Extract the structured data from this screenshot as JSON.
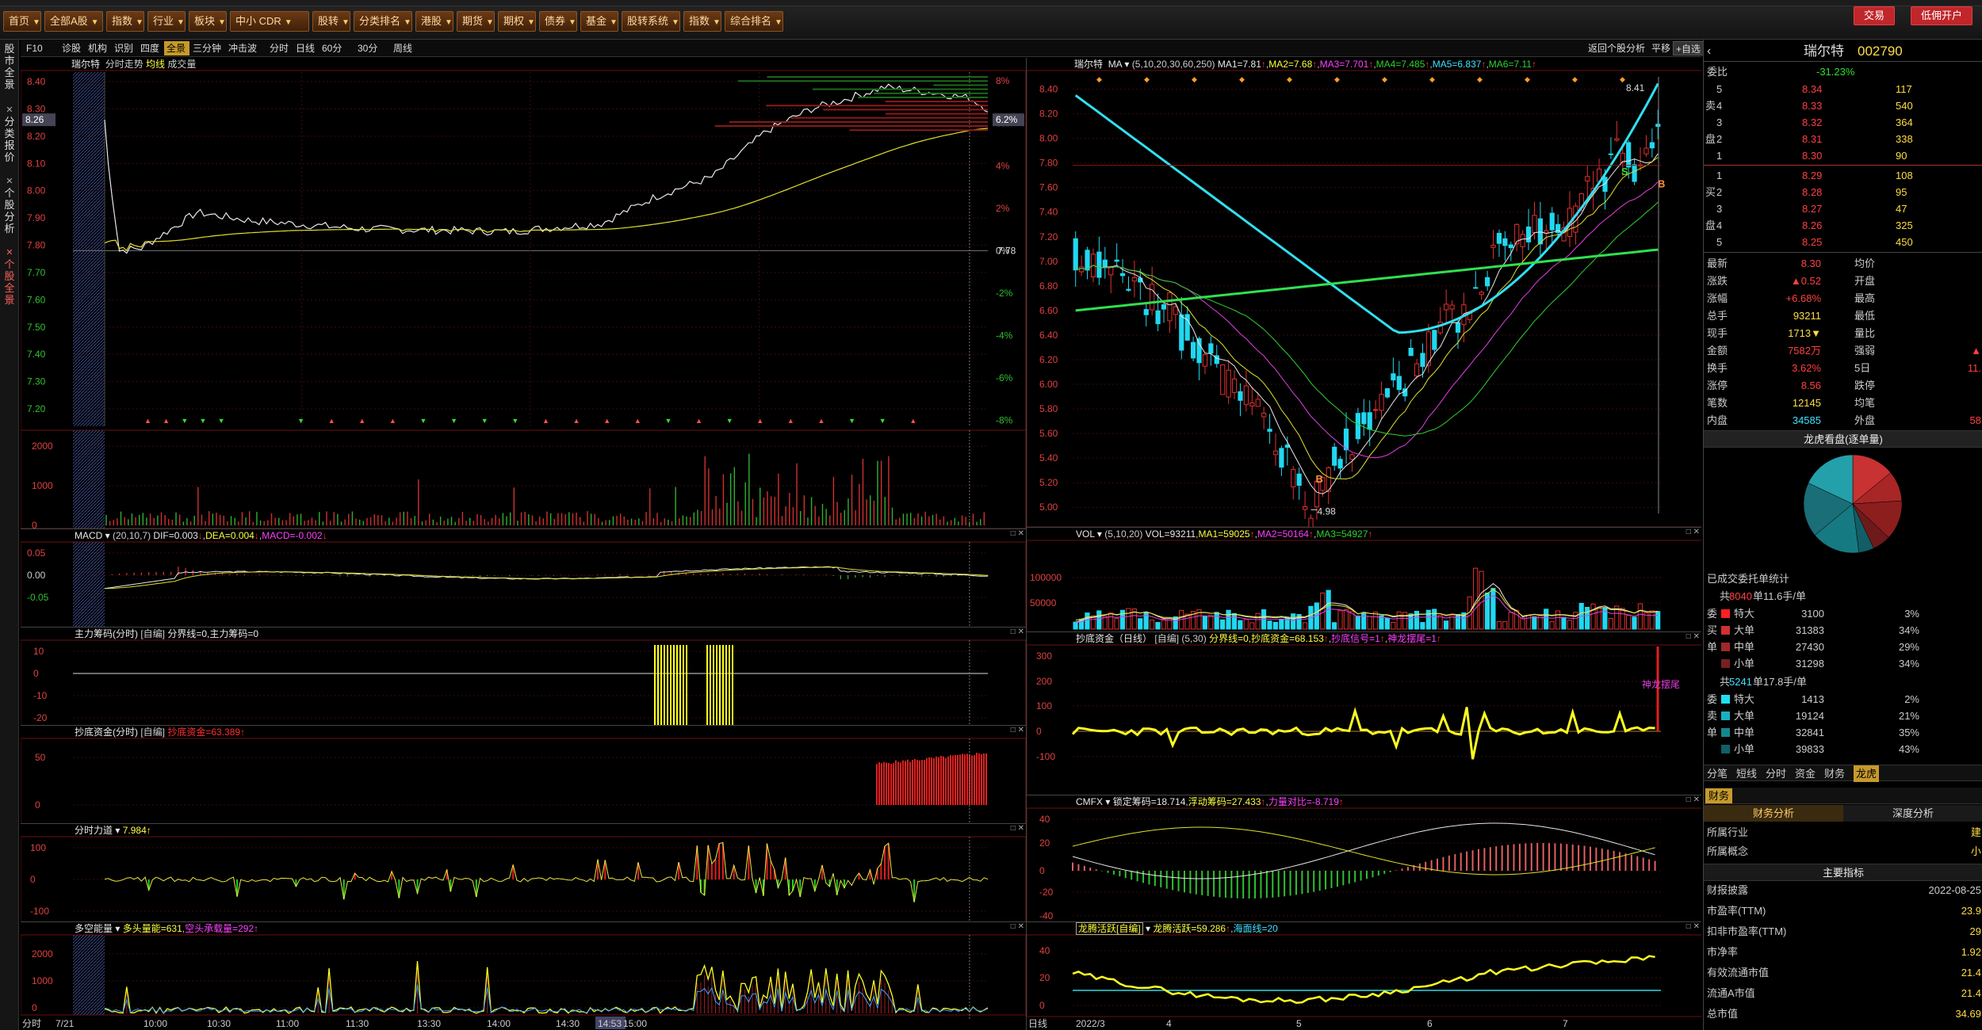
{
  "toolbar": {
    "buttons": [
      "首页",
      "全部A股",
      "指数",
      "行业",
      "板块",
      "中小 CDR",
      "股转",
      "分类排名",
      "港股",
      "期货",
      "期权",
      "债券",
      "基金",
      "股转系统",
      "指数",
      "综合排名"
    ],
    "trade": "交易",
    "open_account": "低佣开户"
  },
  "left_strip": [
    "股市全景",
    "分类报价",
    "个股分析",
    "个股全景"
  ],
  "tabs": [
    "F10",
    "诊股",
    "机构",
    "识别",
    "四度",
    "全景",
    "三分钟",
    "冲击波",
    "分时",
    "日线",
    "60分",
    "30分",
    "周线"
  ],
  "tabs_active": "全景",
  "tabs_right": {
    "back": "返回个股分析",
    "flat": "平移",
    "watch": "+自选"
  },
  "intraday": {
    "header": {
      "name": "瑞尔特",
      "l1": "分时走势",
      "l2": "均线",
      "l3": "成交量"
    },
    "price_ticks": [
      "8.40",
      "8.30",
      "8.20",
      "8.10",
      "8.00",
      "7.90",
      "7.80",
      "7.70",
      "7.60",
      "7.50",
      "7.40",
      "7.30",
      "7.20"
    ],
    "pct_ticks": [
      "8%",
      "6%",
      "4%",
      "2%",
      "0%",
      "-2%",
      "-4%",
      "-6%",
      "-8%"
    ],
    "cur_price": "8.26",
    "cur_pct": "6.2%",
    "ref_price": "7.78",
    "vol_ticks": [
      "2000",
      "1000",
      "0"
    ],
    "time_ticks": [
      "分时",
      "7/21",
      "10:00",
      "10:30",
      "11:00",
      "11:30",
      "13:30",
      "14:00",
      "14:30",
      "14:53",
      "15:00"
    ],
    "macd": {
      "name": "MACD",
      "params": "(20,10,7)",
      "dif": "DIF=0.003",
      "dea": "DEA=0.004",
      "macd": "MACD=-0.002",
      "ticks": [
        "0.05",
        "0.00",
        "-0.05"
      ]
    },
    "zlcm": {
      "name": "主力筹码(分时)",
      "mode": "[自编]",
      "txt": "分界线=0,主力筹码=0",
      "ticks": [
        "10",
        "0",
        "-10",
        "-20"
      ]
    },
    "cdzj": {
      "name": "抄底资金(分时)",
      "mode": "[自编]",
      "txt": "抄底资金=63.389",
      "ticks": [
        "50",
        "0"
      ]
    },
    "fsld": {
      "name": "分时力道",
      "txt": "7.984",
      "ticks": [
        "100",
        "0",
        "-100"
      ]
    },
    "dkn": {
      "name": "多空能量",
      "t1": "多头量能=631",
      "t2": "空头承载量=292",
      "ticks": [
        "2000",
        "1000",
        "0"
      ]
    }
  },
  "kline": {
    "header": {
      "name": "瑞尔特",
      "ma": "MA",
      "params": "(5,10,20,30,60,250)",
      "ma1": "MA1=7.81",
      "ma2": "MA2=7.68",
      "ma3": "MA3=7.701",
      "ma4": "MA4=7.485",
      "ma5": "MA5=6.837",
      "ma6": "MA6=7.11"
    },
    "price_ticks": [
      "8.40",
      "8.20",
      "8.00",
      "7.80",
      "7.60",
      "7.40",
      "7.20",
      "7.00",
      "6.80",
      "6.60",
      "6.40",
      "6.20",
      "6.00",
      "5.80",
      "5.60",
      "5.40",
      "5.20",
      "5.00"
    ],
    "high_label": "8.41",
    "low_label": "4.98",
    "buy_mark": "B",
    "sell_mark": "S",
    "vol": {
      "name": "VOL",
      "params": "(5,10,20)",
      "v": "VOL=93211",
      "ma1": "MA1=59025",
      "ma2": "MA2=50164",
      "ma3": "MA3=54927",
      "ticks": [
        "100000",
        "50000"
      ]
    },
    "cdzj": {
      "name": "抄底资金（日线）",
      "mode": "[自编]",
      "params": "(5,30)",
      "txt": "分界线=0,抄底资金=68.153",
      "sig1": "抄底信号=1",
      "sig2": "神龙摆尾=1",
      "ticks": [
        "300",
        "200",
        "100",
        "0",
        "-100"
      ],
      "tag": "神龙摆尾"
    },
    "cmfx": {
      "name": "CMFX",
      "t1": "锁定筹码=18.714",
      "t2": "浮动筹码=27.433",
      "t3": "力量对比=-8.719",
      "ticks": [
        "40",
        "20",
        "0",
        "-20",
        "-40"
      ]
    },
    "lthy": {
      "name": "龙腾活跃[自编]",
      "t1": "龙腾活跃=59.286",
      "t2": "海面线=20",
      "ticks": [
        "40",
        "20",
        "0"
      ]
    },
    "time_ticks": [
      "日线",
      "2022/3",
      "4",
      "5",
      "6",
      "7"
    ]
  },
  "quote": {
    "name": "瑞尔特",
    "code": "002790",
    "wb_label": "委比",
    "wb_val": "-31.23%",
    "asks": [
      {
        "l": "5",
        "p": "8.34",
        "v": "117"
      },
      {
        "l": "4",
        "p": "8.33",
        "v": "540"
      },
      {
        "l": "3",
        "p": "8.32",
        "v": "364"
      },
      {
        "l": "2",
        "p": "8.31",
        "v": "338"
      },
      {
        "l": "1",
        "p": "8.30",
        "v": "90"
      }
    ],
    "bids": [
      {
        "l": "1",
        "p": "8.29",
        "v": "108"
      },
      {
        "l": "2",
        "p": "8.28",
        "v": "95"
      },
      {
        "l": "3",
        "p": "8.27",
        "v": "47"
      },
      {
        "l": "4",
        "p": "8.26",
        "v": "325"
      },
      {
        "l": "5",
        "p": "8.25",
        "v": "450"
      }
    ],
    "stats": [
      {
        "a": "最新",
        "b": "8.30",
        "c": "均价",
        "d": ""
      },
      {
        "a": "涨跌",
        "b": "▲0.52",
        "c": "开盘",
        "d": ""
      },
      {
        "a": "涨幅",
        "b": "+6.68%",
        "c": "最高",
        "d": ""
      },
      {
        "a": "总手",
        "b": "93211",
        "c": "最低",
        "d": ""
      },
      {
        "a": "现手",
        "b": "1713▼",
        "c": "量比",
        "d": ""
      },
      {
        "a": "金额",
        "b": "7582万",
        "c": "强弱",
        "d": "▲"
      },
      {
        "a": "换手",
        "b": "3.62%",
        "c": "5日",
        "d": "11."
      },
      {
        "a": "涨停",
        "b": "8.56",
        "c": "跌停",
        "d": ""
      },
      {
        "a": "笔数",
        "b": "12145",
        "c": "均笔",
        "d": ""
      },
      {
        "a": "内盘",
        "b": "34585",
        "c": "外盘",
        "d": "58"
      }
    ],
    "lhb_title": "龙虎看盘(逐单量)",
    "pie": [
      {
        "v": 0.14,
        "c": "#c83232"
      },
      {
        "v": 0.1,
        "c": "#a82626"
      },
      {
        "v": 0.13,
        "c": "#8c1e1e"
      },
      {
        "v": 0.06,
        "c": "#6e1a1a"
      },
      {
        "v": 0.05,
        "c": "#125e66"
      },
      {
        "v": 0.16,
        "c": "#167a82"
      },
      {
        "v": 0.18,
        "c": "#1a6e78"
      },
      {
        "v": 0.18,
        "c": "#24a0aa"
      }
    ],
    "deal_title": "已成交委托单统计",
    "buy_total": "共8040单11.6手/单",
    "buy": [
      {
        "k": "特大",
        "n": "3100",
        "p": "3%",
        "c": "#ff2020"
      },
      {
        "k": "大单",
        "n": "31383",
        "p": "34%",
        "c": "#d03030"
      },
      {
        "k": "中单",
        "n": "27430",
        "p": "29%",
        "c": "#a02828"
      },
      {
        "k": "小单",
        "n": "31298",
        "p": "34%",
        "c": "#782020"
      }
    ],
    "buy_side": [
      "委",
      "买",
      "单"
    ],
    "sell_total": "共5241单17.8手/单",
    "sell": [
      {
        "k": "特大",
        "n": "1413",
        "p": "2%",
        "c": "#20e0f0"
      },
      {
        "k": "大单",
        "n": "19124",
        "p": "21%",
        "c": "#18b0c0"
      },
      {
        "k": "中单",
        "n": "32841",
        "p": "35%",
        "c": "#148890"
      },
      {
        "k": "小单",
        "n": "39833",
        "p": "43%",
        "c": "#106068"
      }
    ],
    "sell_side": [
      "委",
      "卖",
      "单"
    ],
    "btabs": [
      "分笔",
      "短线",
      "分时",
      "资金",
      "财务",
      "龙虎"
    ],
    "fin_tab": "财务",
    "fin_tabs": [
      "财务分析",
      "深度分析"
    ],
    "fin_rows": [
      {
        "a": "所属行业",
        "b": "建"
      },
      {
        "a": "所属概念",
        "b": "小"
      }
    ],
    "main_ind": "主要指标",
    "ind_rows": [
      {
        "a": "财报披露",
        "b": "2022-08-25"
      },
      {
        "a": "市盈率(TTM)",
        "b": "23.9"
      },
      {
        "a": "扣非市盈率(TTM)",
        "b": "29"
      },
      {
        "a": "市净率",
        "b": "1.92"
      },
      {
        "a": "有效流通市值",
        "b": "21.4"
      },
      {
        "a": "流通A市值",
        "b": "21.4"
      },
      {
        "a": "总市值",
        "b": "34.69"
      }
    ]
  }
}
